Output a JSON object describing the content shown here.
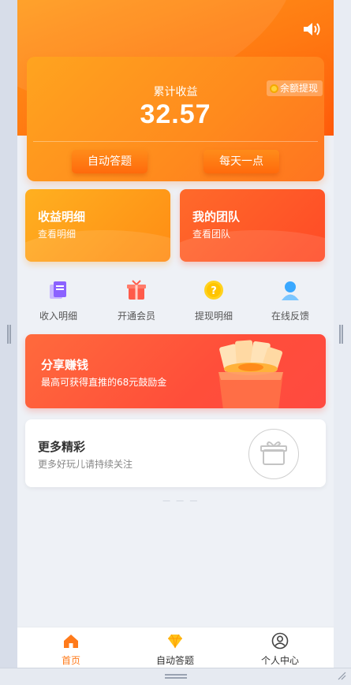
{
  "header": {
    "total_label": "累计收益",
    "total_value": "32.57",
    "withdraw_tag": "余额提现",
    "btn_auto": "自动答题",
    "btn_daily": "每天一点"
  },
  "cards": {
    "income": {
      "title": "收益明细",
      "sub": "查看明细"
    },
    "team": {
      "title": "我的团队",
      "sub": "查看团队"
    }
  },
  "quick": [
    {
      "label": "收入明细",
      "icon": "document-icon"
    },
    {
      "label": "开通会员",
      "icon": "gift-box-icon"
    },
    {
      "label": "提现明细",
      "icon": "question-coin-icon"
    },
    {
      "label": "在线反馈",
      "icon": "user-support-icon"
    }
  ],
  "share": {
    "title": "分享赚钱",
    "sub": "最高可获得直推的68元鼓励金"
  },
  "more": {
    "title": "更多精彩",
    "sub": "更多好玩儿请持续关注"
  },
  "tabs": [
    {
      "label": "首页",
      "icon": "home-icon",
      "active": true
    },
    {
      "label": "自动答题",
      "icon": "diamond-icon",
      "active": false
    },
    {
      "label": "个人中心",
      "icon": "user-icon",
      "active": false
    }
  ],
  "colors": {
    "accent": "#ff7a1a",
    "hero_start": "#ff9a1a",
    "hero_end": "#ff5a0a",
    "share_red": "#ff4e3a"
  }
}
